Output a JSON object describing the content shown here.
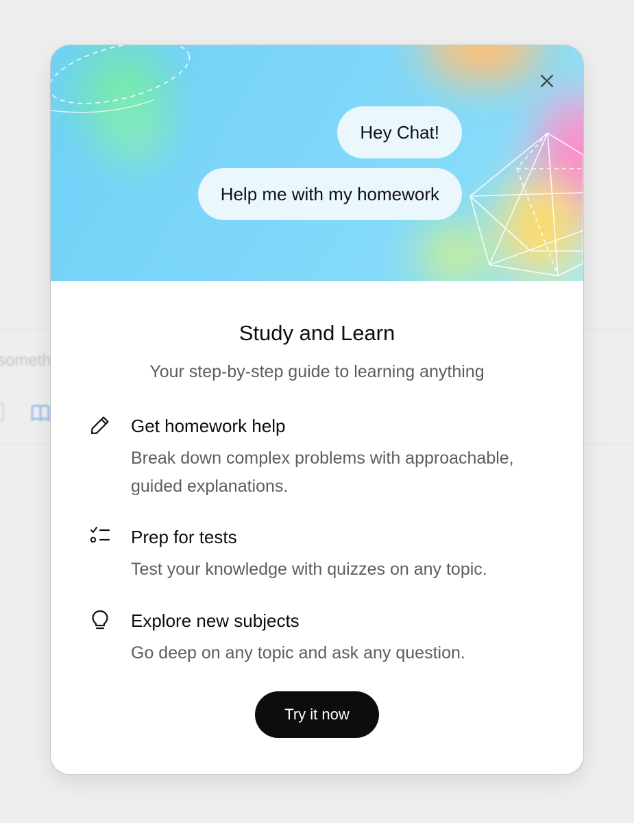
{
  "background": {
    "partial_text": "someth"
  },
  "dialog": {
    "hero": {
      "bubbles": [
        "Hey Chat!",
        "Help me with my homework"
      ]
    },
    "title": "Study and Learn",
    "subtitle": "Your step-by-step guide to learning anything",
    "features": [
      {
        "icon": "pencil-icon",
        "title": "Get homework help",
        "description": "Break down complex problems with approachable, guided explanations."
      },
      {
        "icon": "checklist-icon",
        "title": "Prep for tests",
        "description": "Test your knowledge with quizzes on any topic."
      },
      {
        "icon": "lightbulb-icon",
        "title": "Explore new subjects",
        "description": "Go deep on any topic and ask any question."
      }
    ],
    "cta_label": "Try it now",
    "close_icon": "close-icon"
  },
  "colors": {
    "cta_background": "#0d0d0d",
    "bubble_background": "#eaf7fd",
    "hero_sky": "#7dd6fa"
  }
}
